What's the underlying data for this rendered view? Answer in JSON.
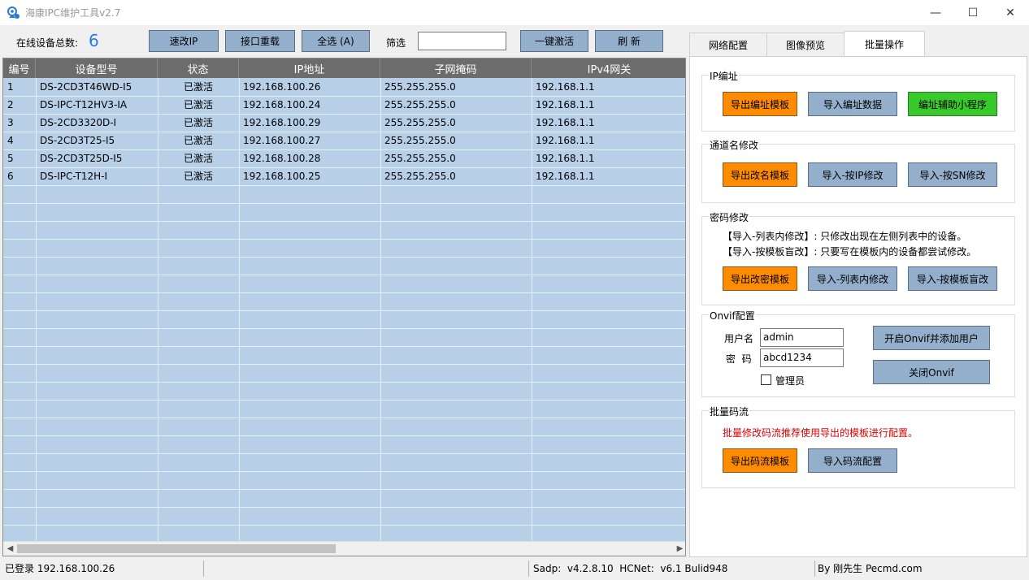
{
  "window": {
    "title": "海康IPC维护工具v2.7",
    "controls": {
      "minimize": "—",
      "maximize": "☐",
      "close": "✕"
    }
  },
  "toolbar": {
    "online_label": "在线设备总数:",
    "online_count": "6",
    "btn_quick_ip": "速改IP",
    "btn_reload": "接口重载",
    "btn_select_all": "全选 (A)",
    "filter_label": "筛选",
    "filter_value": "",
    "btn_activate": "一键激活",
    "btn_refresh": "刷  新"
  },
  "table": {
    "columns": [
      "编号",
      "设备型号",
      "状态",
      "IP地址",
      "子网掩码",
      "IPv4网关"
    ],
    "rows": [
      [
        "1",
        "DS-2CD3T46WD-I5",
        "已激活",
        "192.168.100.26",
        "255.255.255.0",
        "192.168.1.1"
      ],
      [
        "2",
        "DS-IPC-T12HV3-IA",
        "已激活",
        "192.168.100.24",
        "255.255.255.0",
        "192.168.1.1"
      ],
      [
        "3",
        "DS-2CD3320D-I",
        "已激活",
        "192.168.100.29",
        "255.255.255.0",
        "192.168.1.1"
      ],
      [
        "4",
        "DS-2CD3T25-I5",
        "已激活",
        "192.168.100.27",
        "255.255.255.0",
        "192.168.1.1"
      ],
      [
        "5",
        "DS-2CD3T25D-I5",
        "已激活",
        "192.168.100.28",
        "255.255.255.0",
        "192.168.1.1"
      ],
      [
        "6",
        "DS-IPC-T12H-I",
        "已激活",
        "192.168.100.25",
        "255.255.255.0",
        "192.168.1.1"
      ]
    ]
  },
  "tabs": [
    {
      "label": "网络配置",
      "active": false
    },
    {
      "label": "图像预览",
      "active": false
    },
    {
      "label": "批量操作",
      "active": true
    }
  ],
  "panel": {
    "ip_group": {
      "title": "IP编址",
      "btn_export_template": "导出编址模板",
      "btn_import_data": "导入编址数据",
      "btn_helper": "编址辅助小程序"
    },
    "channel_group": {
      "title": "通道名修改",
      "btn_export_template": "导出改名模板",
      "btn_import_ip": "导入-按IP修改",
      "btn_import_sn": "导入-按SN修改"
    },
    "password_group": {
      "title": "密码修改",
      "note1": "【导入-列表内修改】: 只修改出现在左侧列表中的设备。",
      "note2": "【导入-按模板盲改】: 只要写在模板内的设备都尝试修改。",
      "btn_export_template": "导出改密模板",
      "btn_import_list": "导入-列表内修改",
      "btn_import_blind": "导入-按模板盲改"
    },
    "onvif_group": {
      "title": "Onvif配置",
      "username_label": "用户名",
      "username_value": "admin",
      "password_label": "密  码",
      "password_value": "abcd1234",
      "admin_label": "管理员",
      "admin_checked": false,
      "btn_enable": "开启Onvif并添加用户",
      "btn_disable": "关闭Onvif"
    },
    "stream_group": {
      "title": "批量码流",
      "note": "批量修改码流推荐使用导出的模板进行配置。",
      "btn_export_template": "导出码流模板",
      "btn_import_config": "导入码流配置"
    }
  },
  "statusbar": {
    "login": "已登录  192.168.100.26",
    "version": "Sadp:  v4.2.8.10  HCNet:  v6.1 Bulid948",
    "author": "By 刚先生 Pecmd.com"
  },
  "colors": {
    "button_blue": "#93afcc",
    "button_orange": "#ff8c00",
    "button_green": "#39c92a",
    "table_bg": "#b8cfe8",
    "header_bg": "#6c6c6c",
    "count_blue": "#1e7ee8",
    "note_red": "#e00000"
  }
}
